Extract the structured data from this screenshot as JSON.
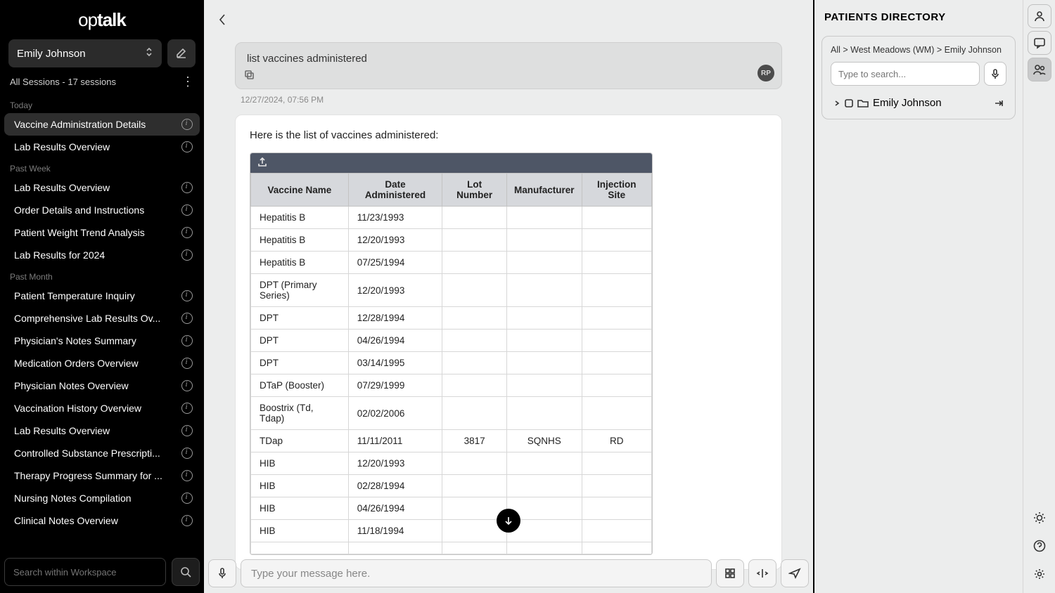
{
  "brand": {
    "a": "op",
    "b": "talk"
  },
  "workspace": {
    "name": "Emily Johnson"
  },
  "sessions_summary": "All Sessions - 17 sessions",
  "groups": [
    {
      "label": "Today",
      "items": [
        {
          "title": "Vaccine Administration Details",
          "active": true
        },
        {
          "title": "Lab Results Overview"
        }
      ]
    },
    {
      "label": "Past Week",
      "items": [
        {
          "title": "Lab Results Overview"
        },
        {
          "title": "Order Details and Instructions"
        },
        {
          "title": "Patient Weight Trend Analysis"
        },
        {
          "title": "Lab Results for 2024"
        }
      ]
    },
    {
      "label": "Past Month",
      "items": [
        {
          "title": "Patient Temperature Inquiry"
        },
        {
          "title": "Comprehensive Lab Results Ov..."
        },
        {
          "title": "Physician's Notes Summary"
        },
        {
          "title": "Medication Orders Overview"
        },
        {
          "title": "Physician Notes Overview"
        },
        {
          "title": "Vaccination History Overview"
        },
        {
          "title": "Lab Results Overview"
        },
        {
          "title": "Controlled Substance Prescripti..."
        },
        {
          "title": "Therapy Progress Summary for ..."
        },
        {
          "title": "Nursing Notes Compilation"
        },
        {
          "title": "Clinical Notes Overview"
        }
      ]
    }
  ],
  "sidebar_search_placeholder": "Search within Workspace",
  "chat": {
    "user_msg": "list vaccines administered",
    "user_initials": "RP",
    "timestamp": "12/27/2024, 07:56 PM",
    "assistant_msg": "Here is the list of vaccines administered:",
    "composer_placeholder": "Type your message here."
  },
  "table": {
    "headers": [
      "Vaccine Name",
      "Date Administered",
      "Lot Number",
      "Manufacturer",
      "Injection Site"
    ],
    "rows": [
      [
        "Hepatitis B",
        "11/23/1993",
        "",
        "",
        ""
      ],
      [
        "Hepatitis B",
        "12/20/1993",
        "",
        "",
        ""
      ],
      [
        "Hepatitis B",
        "07/25/1994",
        "",
        "",
        ""
      ],
      [
        "DPT (Primary Series)",
        "12/20/1993",
        "",
        "",
        ""
      ],
      [
        "DPT",
        "12/28/1994",
        "",
        "",
        ""
      ],
      [
        "DPT",
        "04/26/1994",
        "",
        "",
        ""
      ],
      [
        "DPT",
        "03/14/1995",
        "",
        "",
        ""
      ],
      [
        "DTaP (Booster)",
        "07/29/1999",
        "",
        "",
        ""
      ],
      [
        "Boostrix (Td, Tdap)",
        "02/02/2006",
        "",
        "",
        ""
      ],
      [
        "TDap",
        "11/11/2011",
        "3817",
        "SQNHS",
        "RD"
      ],
      [
        "HIB",
        "12/20/1993",
        "",
        "",
        ""
      ],
      [
        "HIB",
        "02/28/1994",
        "",
        "",
        ""
      ],
      [
        "HIB",
        "04/26/1994",
        "",
        "",
        ""
      ],
      [
        "HIB",
        "11/18/1994",
        "",
        "",
        ""
      ],
      [
        "",
        "",
        "",
        "",
        ""
      ]
    ]
  },
  "right": {
    "title": "PATIENTS DIRECTORY",
    "breadcrumbs": [
      "All",
      "West Meadows (WM)",
      "Emily Johnson"
    ],
    "search_placeholder": "Type to search...",
    "tree_item": "Emily Johnson"
  }
}
